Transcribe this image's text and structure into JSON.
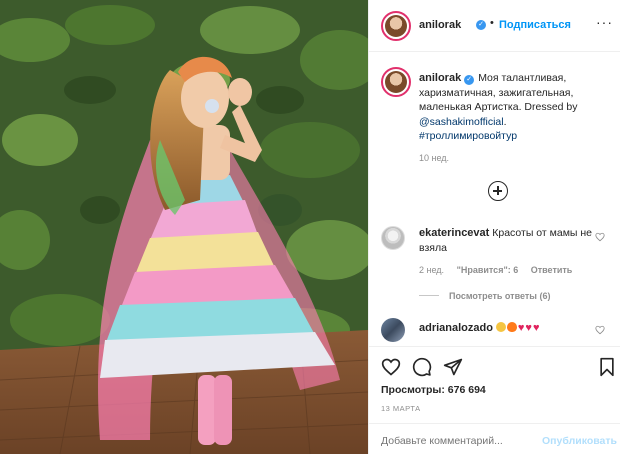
{
  "post": {
    "username": "anilorak",
    "follow_label": "Подписаться",
    "separator": "•",
    "more_label": "···",
    "caption_text": "Моя талантливая, харизматичная, зажигательная, маленькая Артистка. Dressed by ",
    "caption_mention": "@sashakimofficial",
    "caption_after": ".",
    "caption_hashtag": "#троллимировойтур",
    "time_ago": "10 нед."
  },
  "comments": [
    {
      "username": "ekaterincevat",
      "text": "Красоты от мамы не взяла",
      "time": "2 нед.",
      "likes": "\"Нравится\": 6",
      "reply_label": "Ответить",
      "view_replies": "Посмотреть ответы (6)"
    },
    {
      "username": "adrianalozado",
      "text": ""
    }
  ],
  "footer": {
    "views": "Просмотры: 676 694",
    "date": "13 МАРТА",
    "add_comment_placeholder": "Добавьте комментарий...",
    "publish_label": "Опубликовать"
  },
  "icons": {
    "verified": "verified-badge-icon",
    "load_more": "plus-circle-icon",
    "like": "heart-icon",
    "comment": "comment-icon",
    "share": "share-icon",
    "save": "bookmark-icon"
  },
  "colors": {
    "accent": "#0095f6",
    "link": "#00376b",
    "muted": "#8e8e8e",
    "verified": "#3897f0"
  }
}
